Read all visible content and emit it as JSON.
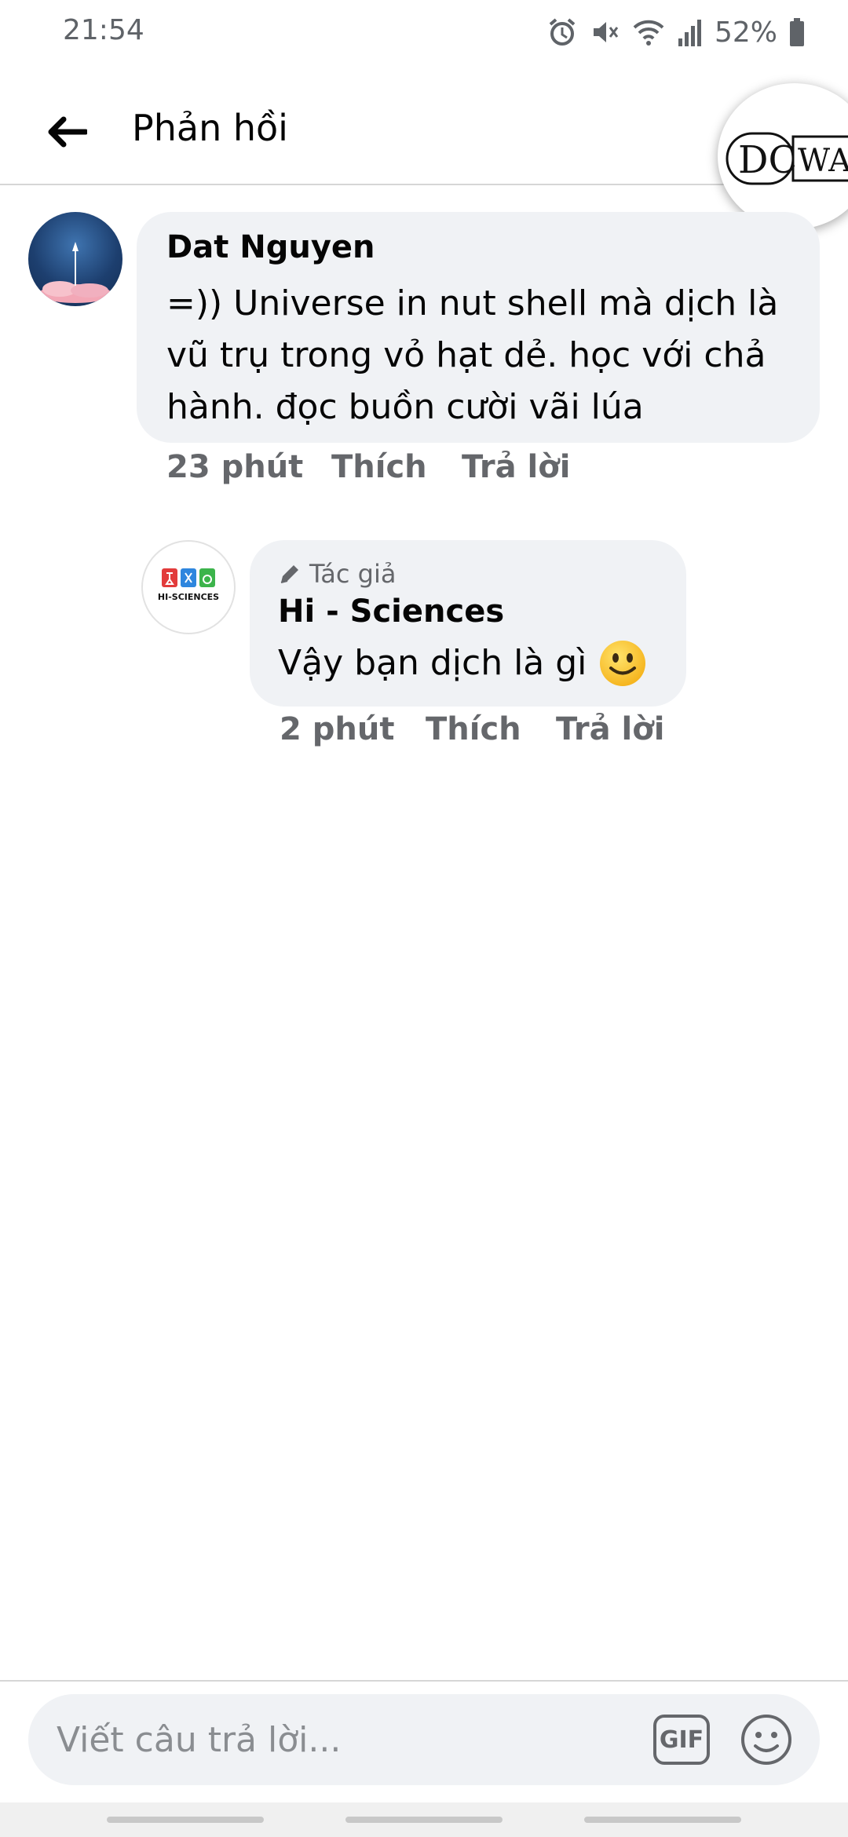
{
  "status_bar": {
    "time": "21:54",
    "battery_percent": "52%",
    "icons": [
      "alarm-icon",
      "mute-icon",
      "wifi-icon",
      "signal-icon",
      "battery-icon"
    ]
  },
  "header": {
    "title": "Phản hồi",
    "back_icon": "arrow-left-icon",
    "logo_text": "DC WAC"
  },
  "comments": [
    {
      "author": "Dat Nguyen",
      "text": "=)) Universe in nut shell mà dịch là vũ trụ trong vỏ hạt dẻ. học với chả hành. đọc buồn cười vãi lúa",
      "time": "23 phút",
      "like_label": "Thích",
      "reply_label": "Trả lời"
    }
  ],
  "replies": [
    {
      "author_tag": "Tác giả",
      "author": "Hi - Sciences",
      "text": "Vậy bạn dịch là gì",
      "emoji": "slightly-smiling-face",
      "avatar_text": "HI-SCIENCES",
      "time": "2 phút",
      "like_label": "Thích",
      "reply_label": "Trả lời"
    }
  ],
  "composer": {
    "placeholder": "Viết câu trả lời...",
    "gif_label": "GIF",
    "emoji_icon": "smiley-icon"
  },
  "colors": {
    "bubble": "#f0f2f5",
    "secondary_text": "#65676b",
    "primary_text": "#050505"
  }
}
